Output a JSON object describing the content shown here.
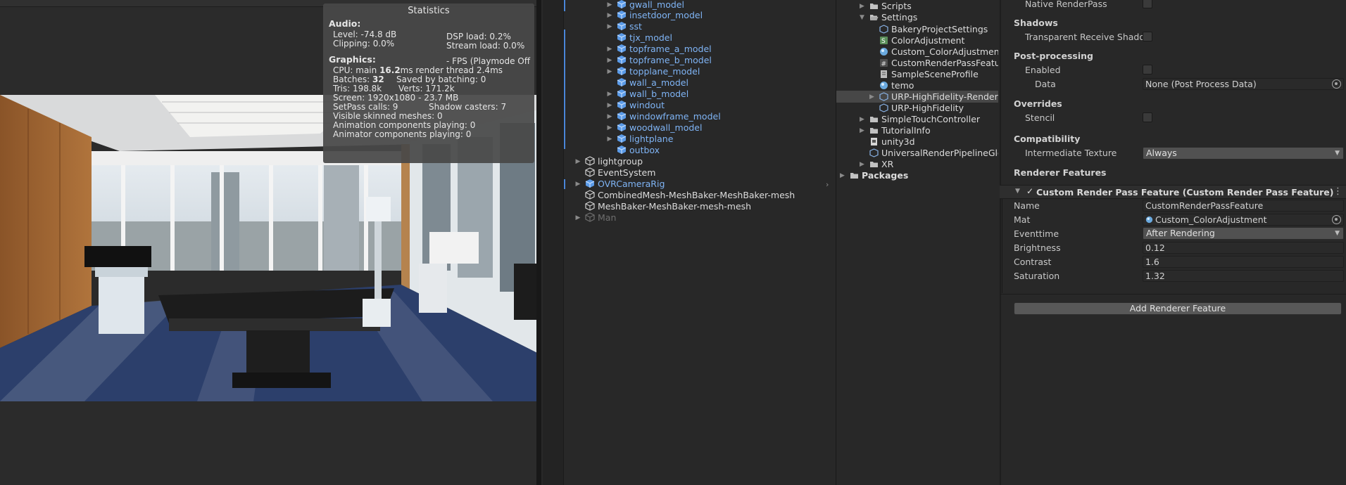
{
  "statistics": {
    "title": "Statistics",
    "audio_heading": "Audio:",
    "level": "Level: -74.8 dB",
    "clipping": "Clipping: 0.0%",
    "dsp_load": "DSP load: 0.2%",
    "stream_load": "Stream load: 0.0%",
    "graphics_heading": "Graphics:",
    "fps": "- FPS (Playmode Off",
    "cpu_prefix": "CPU: main ",
    "cpu_main": "16.2",
    "cpu_suffix": "ms  render thread 2.4ms",
    "batches_prefix": "Batches: ",
    "batches": "32",
    "saved_batching": "Saved by batching: 0",
    "tris": "Tris: 198.8k",
    "verts": "Verts: 171.2k",
    "screen": "Screen: 1920x1080 - 23.7 MB",
    "setpass": "SetPass calls: 9",
    "shadow_casters": "Shadow casters: 7",
    "skinned_meshes": "Visible skinned meshes: 0",
    "animation_components": "Animation components playing: 0",
    "animator_components": "Animator components playing: 0"
  },
  "hierarchy": {
    "items": [
      {
        "label": "gwall_model",
        "expandable": true
      },
      {
        "label": "insetdoor_model",
        "expandable": true
      },
      {
        "label": "sst",
        "expandable": true
      },
      {
        "label": "tjx_model",
        "expandable": false
      },
      {
        "label": "topframe_a_model",
        "expandable": true
      },
      {
        "label": "topframe_b_model",
        "expandable": true
      },
      {
        "label": "topplane_model",
        "expandable": true
      },
      {
        "label": "wall_a_model",
        "expandable": false
      },
      {
        "label": "wall_b_model",
        "expandable": true
      },
      {
        "label": "windout",
        "expandable": true
      },
      {
        "label": "windowframe_model",
        "expandable": true
      },
      {
        "label": "woodwall_model",
        "expandable": true
      },
      {
        "label": "lightplane",
        "expandable": true
      },
      {
        "label": "outbox",
        "expandable": false
      },
      {
        "label": "lightgroup",
        "expandable": true
      },
      {
        "label": "EventSystem",
        "expandable": false
      },
      {
        "label": "OVRCameraRig",
        "expandable": true
      },
      {
        "label": "CombinedMesh-MeshBaker-MeshBaker-mesh",
        "expandable": false
      },
      {
        "label": "MeshBaker-MeshBaker-mesh-mesh",
        "expandable": false
      },
      {
        "label": "Man",
        "expandable": true
      }
    ]
  },
  "project": {
    "items": [
      {
        "label": "Scripts"
      },
      {
        "label": "Settings"
      },
      {
        "label": "BakeryProjectSettings"
      },
      {
        "label": "ColorAdjustment"
      },
      {
        "label": "Custom_ColorAdjustment"
      },
      {
        "label": "CustomRenderPassFeature"
      },
      {
        "label": "SampleSceneProfile"
      },
      {
        "label": "temo"
      },
      {
        "label": "URP-HighFidelity-Renderer"
      },
      {
        "label": "URP-HighFidelity"
      },
      {
        "label": "SimpleTouchController"
      },
      {
        "label": "TutorialInfo"
      },
      {
        "label": "unity3d"
      },
      {
        "label": "UniversalRenderPipelineGlobalS"
      },
      {
        "label": "XR"
      },
      {
        "label": "Packages"
      }
    ]
  },
  "inspector": {
    "native_render_pass": "Native RenderPass",
    "shadows_heading": "Shadows",
    "transparent_receive_shadow": "Transparent Receive Shadow",
    "post_processing_heading": "Post-processing",
    "enabled": "Enabled",
    "data_label": "Data",
    "data_value": "None (Post Process Data)",
    "overrides_heading": "Overrides",
    "stencil": "Stencil",
    "compatibility_heading": "Compatibility",
    "intermediate_texture": "Intermediate Texture",
    "intermediate_texture_value": "Always",
    "renderer_features_heading": "Renderer Features",
    "feature_title": "Custom Render Pass Feature (Custom Render Pass Feature)",
    "name_label": "Name",
    "name_value": "CustomRenderPassFeature",
    "mat_label": "Mat",
    "mat_value": "Custom_ColorAdjustment",
    "eventtime_label": "Eventtime",
    "eventtime_value": "After Rendering",
    "brightness_label": "Brightness",
    "brightness_value": "0.12",
    "contrast_label": "Contrast",
    "contrast_value": "1.6",
    "saturation_label": "Saturation",
    "saturation_value": "1.32",
    "add_button": "Add Renderer Feature"
  },
  "colors": {
    "prefab_blue": "#7fb4f5",
    "panel_bg": "#282828",
    "selection": "#474747"
  }
}
